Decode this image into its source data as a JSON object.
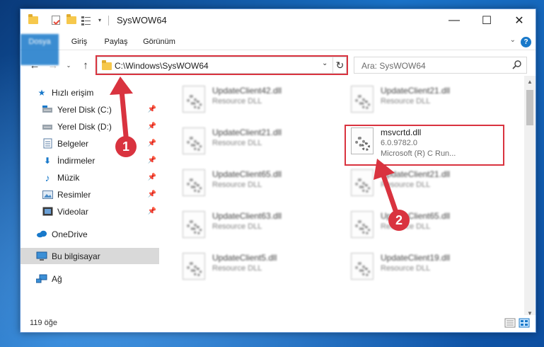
{
  "window": {
    "title": "SysWOW64",
    "controls": {
      "minimize": "—",
      "maximize": "☐",
      "close": "✕"
    }
  },
  "ribbon": {
    "tabs": [
      "Dosya",
      "Giriş",
      "Paylaş",
      "Görünüm"
    ],
    "help": "?"
  },
  "navigation": {
    "address": "C:\\Windows\\SysWOW64",
    "search_placeholder": "Ara: SysWOW64"
  },
  "sidebar": {
    "items": [
      {
        "label": "Hızlı erişim",
        "icon": "star-icon",
        "pinned": false
      },
      {
        "label": "Yerel Disk (C:)",
        "icon": "drive-icon",
        "pinned": true
      },
      {
        "label": "Yerel Disk (D:)",
        "icon": "drive-icon",
        "pinned": true
      },
      {
        "label": "Belgeler",
        "icon": "documents-icon",
        "pinned": true
      },
      {
        "label": "İndirmeler",
        "icon": "download-icon",
        "pinned": true
      },
      {
        "label": "Müzik",
        "icon": "music-icon",
        "pinned": true
      },
      {
        "label": "Resimler",
        "icon": "pictures-icon",
        "pinned": true
      },
      {
        "label": "Videolar",
        "icon": "videos-icon",
        "pinned": true
      },
      {
        "label": "OneDrive",
        "icon": "cloud-icon",
        "pinned": false
      },
      {
        "label": "Bu bilgisayar",
        "icon": "computer-icon",
        "pinned": false,
        "selected": true
      },
      {
        "label": "Ağ",
        "icon": "network-icon",
        "pinned": false
      }
    ]
  },
  "files": [
    {
      "name": "UpdateClient42.dll",
      "line2": "Resource DLL",
      "line3": ""
    },
    {
      "name": "UpdateClient21.dll",
      "line2": "Resource DLL",
      "line3": ""
    },
    {
      "name": "UpdateClient21.dll",
      "line2": "Resource DLL",
      "line3": ""
    },
    {
      "name": "msvcrtd.dll",
      "line2": "6.0.9782.0",
      "line3": "Microsoft (R) C Run..."
    },
    {
      "name": "UpdateClient65.dll",
      "line2": "Resource DLL",
      "line3": ""
    },
    {
      "name": "UpdateClient21.dll",
      "line2": "Resource DLL",
      "line3": ""
    },
    {
      "name": "UpdateClient63.dll",
      "line2": "Resource DLL",
      "line3": ""
    },
    {
      "name": "UpdateClient65.dll",
      "line2": "Resource DLL",
      "line3": ""
    },
    {
      "name": "UpdateClient5.dll",
      "line2": "Resource DLL",
      "line3": ""
    },
    {
      "name": "UpdateClient19.dll",
      "line2": "Resource DLL",
      "line3": ""
    }
  ],
  "status": {
    "item_count": "119 öğe"
  },
  "annotations": {
    "badge1": "1",
    "badge2": "2",
    "color": "#d9333f"
  }
}
